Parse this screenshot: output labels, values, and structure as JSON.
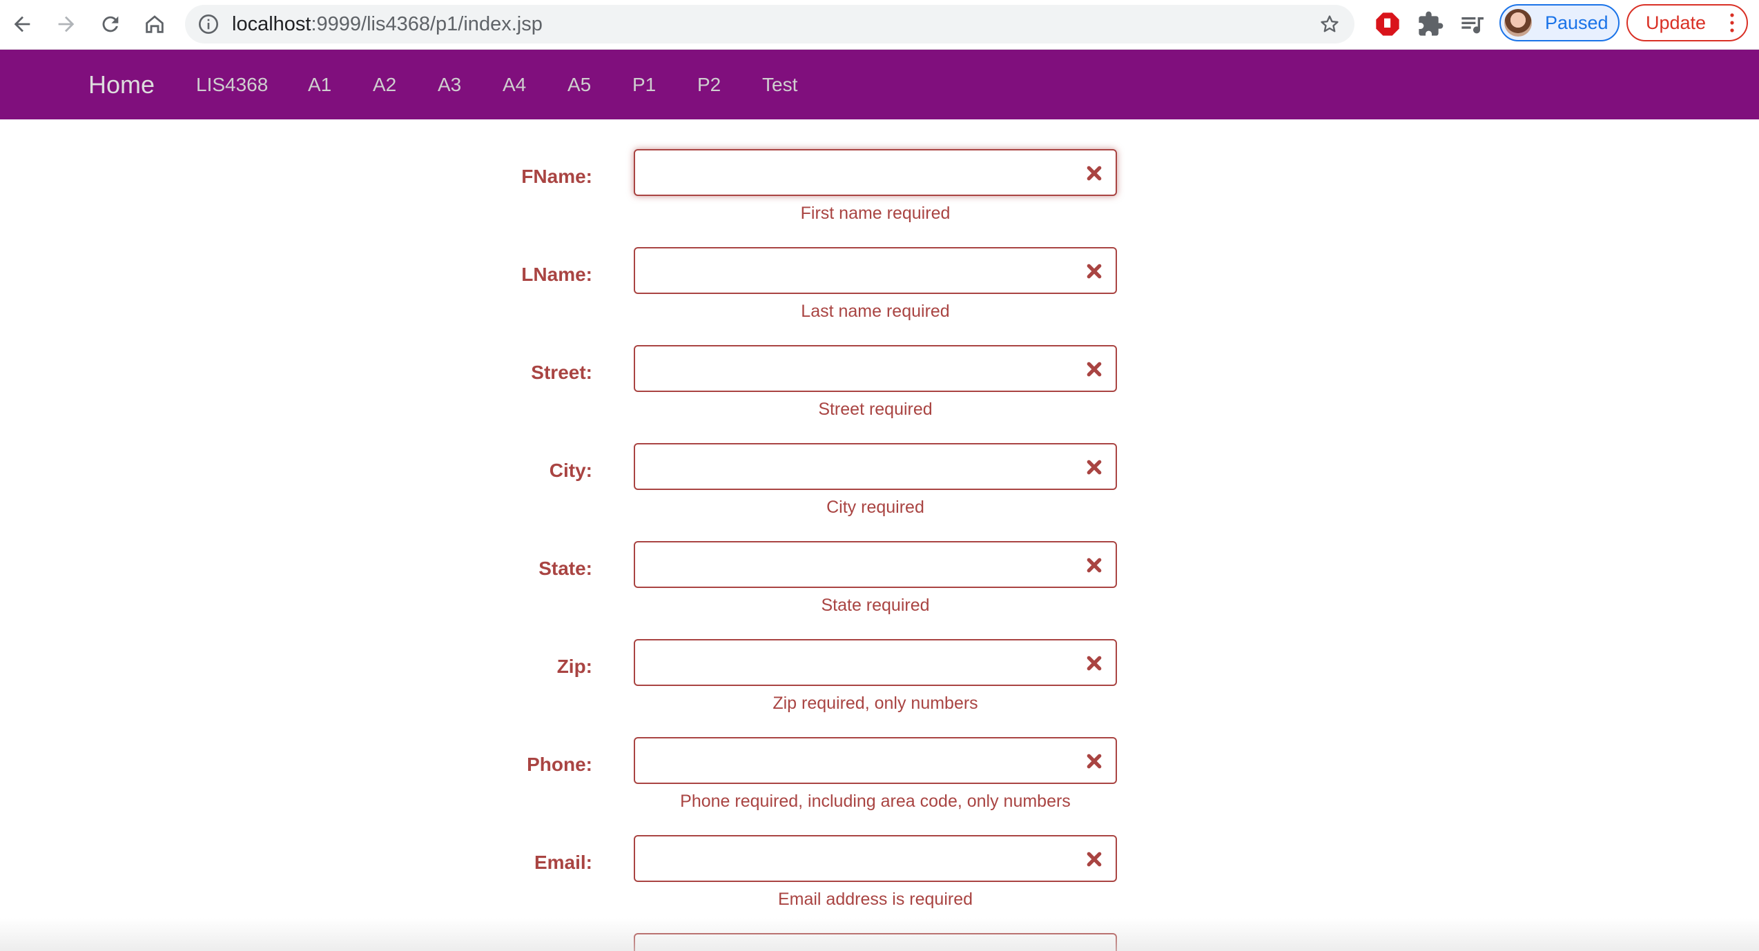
{
  "browser": {
    "url_host": "localhost",
    "url_path": ":9999/lis4368/p1/index.jsp",
    "profile_label": "Paused",
    "update_label": "Update"
  },
  "navbar": {
    "brand": "Home",
    "links": [
      "LIS4368",
      "A1",
      "A2",
      "A3",
      "A4",
      "A5",
      "P1",
      "P2",
      "Test"
    ]
  },
  "form": {
    "fields": [
      {
        "label": "FName:",
        "value": "",
        "error": "First name required"
      },
      {
        "label": "LName:",
        "value": "",
        "error": "Last name required"
      },
      {
        "label": "Street:",
        "value": "",
        "error": "Street required"
      },
      {
        "label": "City:",
        "value": "",
        "error": "City required"
      },
      {
        "label": "State:",
        "value": "",
        "error": "State required"
      },
      {
        "label": "Zip:",
        "value": "",
        "error": "Zip required, only numbers"
      },
      {
        "label": "Phone:",
        "value": "",
        "error": "Phone required, including area code, only numbers"
      },
      {
        "label": "Email:",
        "value": "",
        "error": "Email address is required"
      }
    ]
  },
  "colors": {
    "navbar_bg": "#800f7d",
    "error": "#a94442"
  }
}
